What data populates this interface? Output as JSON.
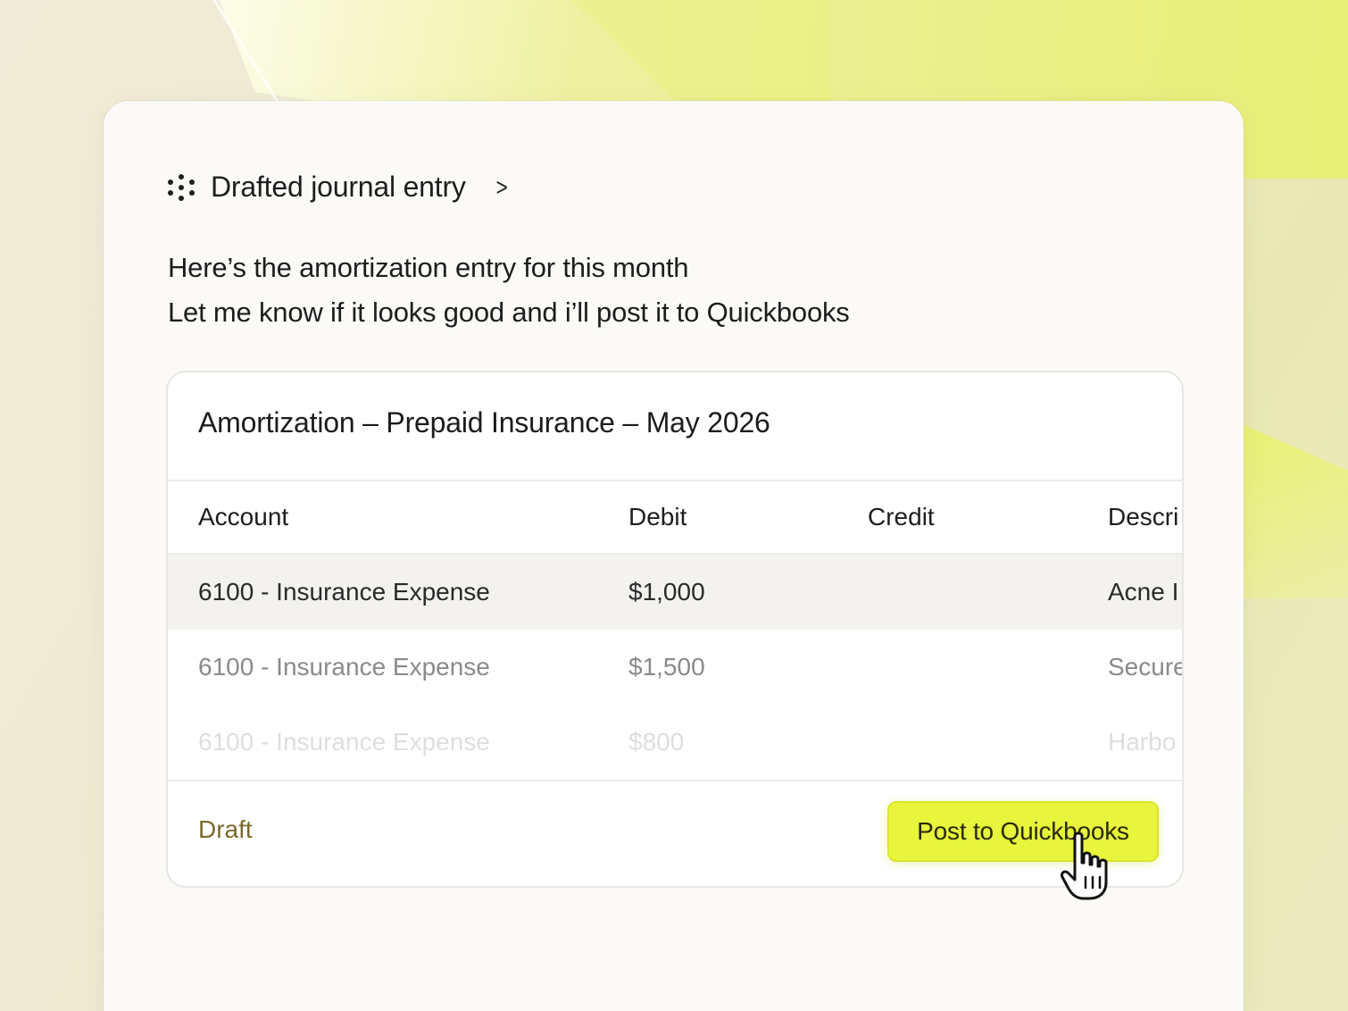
{
  "header": {
    "title": "Drafted journal entry",
    "icon": "dots-grid-icon",
    "chevron": "chevron-right-icon"
  },
  "message": {
    "line1": "Here’s the amortization entry for this month",
    "line2": "Let me know if it looks good and i’ll post it to Quickbooks"
  },
  "entry": {
    "title": "Amortization – Prepaid Insurance – May 2026",
    "columns": [
      "Account",
      "Debit",
      "Credit",
      "Descri"
    ],
    "rows": [
      {
        "account": "6100 - Insurance Expense",
        "debit": "$1,000",
        "credit": "",
        "description": "Acne I"
      },
      {
        "account": "6100 - Insurance Expense",
        "debit": "$1,500",
        "credit": "",
        "description": "Secure"
      },
      {
        "account": "6100 - Insurance Expense",
        "debit": "$800",
        "credit": "",
        "description": "Harbo"
      }
    ],
    "status": "Draft",
    "post_label": "Post to Quickbooks"
  },
  "colors": {
    "accent": "#e8f53c",
    "status": "#7c6a2c",
    "card": "#fbfaf7"
  }
}
